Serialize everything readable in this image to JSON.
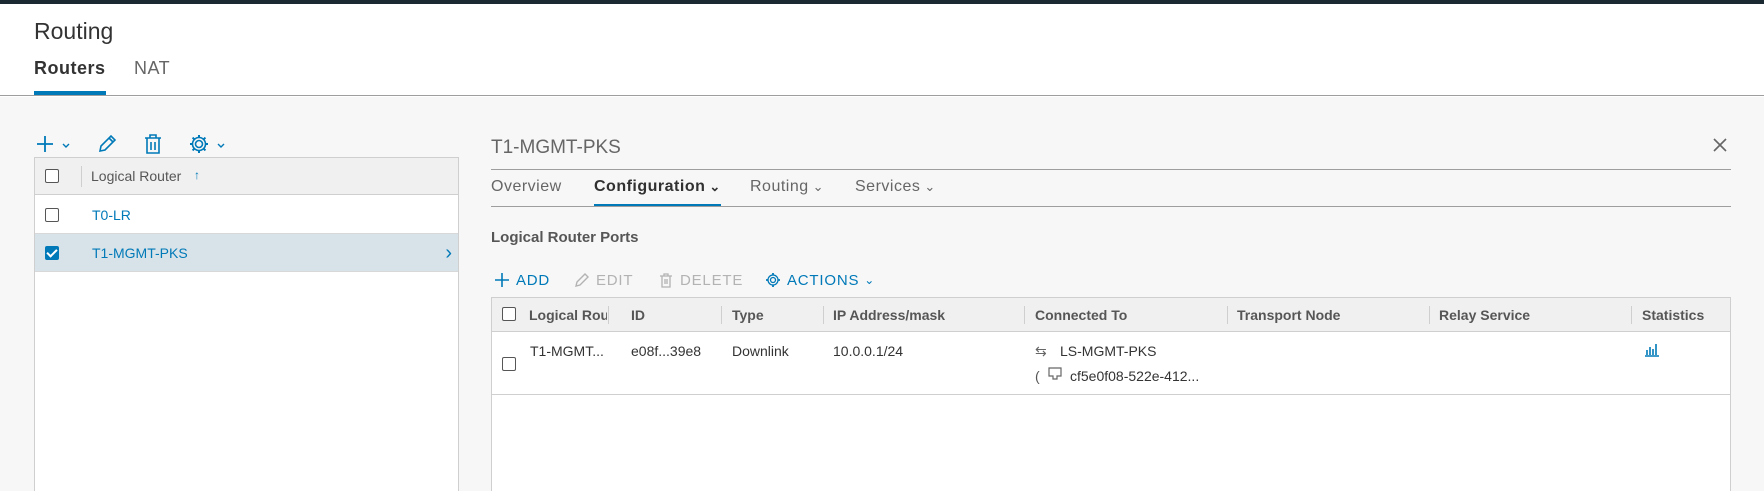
{
  "page": {
    "title": "Routing"
  },
  "top_tabs": [
    {
      "label": "Routers",
      "active": true
    },
    {
      "label": "NAT",
      "active": false
    }
  ],
  "toolbar": {
    "icons": [
      "add-icon",
      "edit-icon",
      "delete-icon",
      "gear-icon"
    ]
  },
  "router_list": {
    "column_header": "Logical Router",
    "sort": "ascending",
    "rows": [
      {
        "name": "T0-LR",
        "selected": false
      },
      {
        "name": "T1-MGMT-PKS",
        "selected": true
      }
    ]
  },
  "detail": {
    "title": "T1-MGMT-PKS",
    "tabs": [
      {
        "label": "Overview",
        "active": false,
        "dropdown": false
      },
      {
        "label": "Configuration",
        "active": true,
        "dropdown": true
      },
      {
        "label": "Routing",
        "active": false,
        "dropdown": true
      },
      {
        "label": "Services",
        "active": false,
        "dropdown": true
      }
    ],
    "section_title": "Logical Router Ports",
    "actions": {
      "add": "ADD",
      "edit": "EDIT",
      "delete": "DELETE",
      "actions": "ACTIONS"
    },
    "ports_table": {
      "columns": [
        "Logical Route",
        "ID",
        "Type",
        "IP Address/mask",
        "Connected To",
        "Transport Node",
        "Relay Service",
        "Statistics"
      ],
      "rows": [
        {
          "logical_router": "T1-MGMT...",
          "id": "e08f...39e8",
          "type": "Downlink",
          "ip_mask": "10.0.0.1/24",
          "connected_switch": "LS-MGMT-PKS",
          "connected_prefix": "(",
          "connected_port": "cf5e0f08-522e-412...",
          "transport_node": "",
          "relay_service": ""
        }
      ]
    }
  },
  "colors": {
    "accent": "#0079b8",
    "selected_row": "#d8e3e9",
    "header_bar": "#1b2a32"
  }
}
